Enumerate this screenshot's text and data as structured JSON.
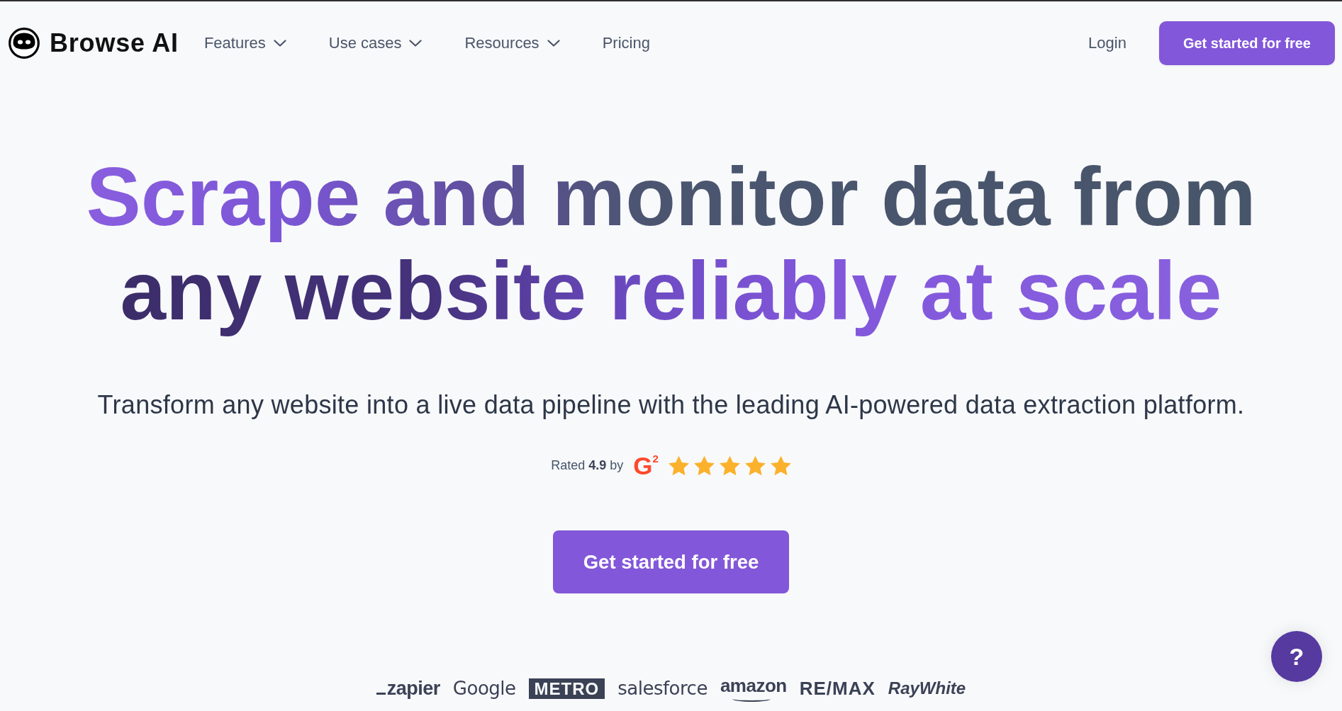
{
  "header": {
    "logo": "Browse AI",
    "nav": [
      {
        "label": "Features",
        "dropdown": true
      },
      {
        "label": "Use cases",
        "dropdown": true
      },
      {
        "label": "Resources",
        "dropdown": true
      },
      {
        "label": "Pricing",
        "dropdown": false
      }
    ],
    "login": "Login",
    "cta": "Get started for free"
  },
  "hero": {
    "headline": "Scrape and monitor data from any website reliably at scale",
    "subtitle": "Transform any website into a live data pipeline with the leading AI-powered data extraction platform.",
    "rating": {
      "text": "Rated **4.9** by",
      "site_logo": "G$^{2}$",
      "stars": 5
    },
    "cta": "Get started for free"
  },
  "logos": [
    {
      "name": "zapier",
      "kind": "dash"
    },
    {
      "name": "Google",
      "kind": "light"
    },
    {
      "name": "METRO",
      "kind": "boxed"
    },
    {
      "name": "salesforce",
      "kind": "light"
    },
    {
      "name": "amazon",
      "kind": "smile"
    },
    {
      "name": "RE/MAX",
      "kind": "bold"
    },
    {
      "name": "RayWhite",
      "kind": "italic"
    }
  ],
  "help_button": {
    "label": "?"
  }
}
